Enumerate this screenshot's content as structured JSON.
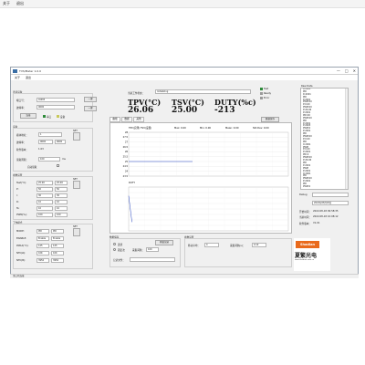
{
  "menubar": {
    "items": [
      "关于",
      "退出"
    ]
  },
  "window": {
    "title": "TVS/Meter 1.0.0",
    "min": "—",
    "max": "□",
    "close": "✕"
  },
  "app_menu": {
    "items": [
      "关于",
      "退出"
    ]
  },
  "connection": {
    "group_label": "连接设备",
    "port_label": "端口号：",
    "port_value": "COM3",
    "baud_label": "波特率：",
    "baud_value": "9600",
    "connect_btn": "连接",
    "serial_label": "串口",
    "device_label": "设备"
  },
  "device": {
    "group_label": "设备",
    "addr_label": "模块地址：",
    "addr_value": "1",
    "rate_label": "波特率：",
    "rate_value": "9600",
    "ver_label": "软件版本：",
    "ver_value": "1.03",
    "read_label": "读取周期：",
    "read_value": "100",
    "read_unit": "ms",
    "auto_label": "自动读取",
    "set_btn": "SET"
  },
  "params": {
    "group_label": "参数设置",
    "rows": [
      {
        "label": "Tset(°C):",
        "v1": "25.00",
        "v2": "25.00"
      },
      {
        "label": "P:",
        "v1": "50",
        "v2": "50"
      },
      {
        "label": "I:",
        "v1": "30",
        "v2": "30"
      },
      {
        "label": "D:",
        "v1": "10",
        "v2": "10"
      },
      {
        "label": "Ts:",
        "v1": "10",
        "v2": "10"
      },
      {
        "label": "PWM(%):",
        "v1": "100",
        "v2": "100"
      }
    ],
    "set_btn": "SET"
  },
  "mode": {
    "group_label": "工作模式",
    "rows": [
      {
        "label": "MODE:",
        "value": "PID"
      },
      {
        "label": "ENABLE:",
        "value": "Enable"
      },
      {
        "label": "PMAX(°C):",
        "value": "125"
      },
      {
        "label": "NTC(Ω):",
        "value": "10K"
      },
      {
        "label": "NTC(B):",
        "value": "3950"
      }
    ],
    "set_btn": "SET"
  },
  "top_buttons": {
    "btn1": "一键",
    "btn2": "一键"
  },
  "work_state": {
    "label": "当前工作状态：",
    "value": "Initializing"
  },
  "readouts": {
    "tpv_label": "TPV(°C)",
    "tpv_value": "26.06",
    "tsv_label": "TSV(°C)",
    "tsv_value": "25.00",
    "duty_label": "DUTY(%c)",
    "duty_value": "-213"
  },
  "status_legend": {
    "items": [
      "Test",
      "Ready",
      "Error"
    ],
    "colors": [
      "#2e8b3a",
      "#9a9a9a",
      "#9a9a9a"
    ]
  },
  "tabs": [
    "曲线",
    "数据",
    "其他"
  ],
  "save_btn": "数据保存",
  "chart_header": {
    "title": "TPV(实测) TSV(设置)",
    "max": "Max: 0.00",
    "min": "Min: 0.00",
    "mean": "Mean: 0.00",
    "std": "Std.Dev: 0.00"
  },
  "chart_data": [
    {
      "type": "line",
      "title": "",
      "ylabel": "",
      "x": [
        0,
        1,
        2,
        3,
        4
      ],
      "series": [
        {
          "name": "",
          "values": [
            25,
            25,
            25,
            25,
            25
          ]
        }
      ],
      "ylim": [
        23.5,
        28
      ],
      "yticks": [
        "28",
        "27.5",
        "27",
        "26.5",
        "26",
        "25.5",
        "25",
        "24.5",
        "24",
        "23.5"
      ],
      "xticks": [
        "0",
        "1",
        "2",
        "3",
        "4",
        "5",
        "6",
        "7",
        "8",
        "9",
        "10"
      ],
      "grid": true
    },
    {
      "type": "line",
      "title": "DUTY",
      "x": [
        0,
        1,
        2,
        3
      ],
      "series": [
        {
          "name": "",
          "values": [
            -20,
            -40,
            -60,
            -80
          ]
        }
      ],
      "ylim": [
        -100,
        0
      ],
      "grid": true
    }
  ],
  "data_save": {
    "group_label": "数据保存",
    "opt1": "连续",
    "opt2": "固定次",
    "interval_label": "采集间隔：",
    "interval_value": "100",
    "record_btn": "开始记录",
    "file_label": "记录文件："
  },
  "param_settings": {
    "group_label": "参数设置",
    "item1_label": "移动平均：",
    "item1_value": "4",
    "item2_label": "采集间隔(s)：",
    "item2_value": "0.10"
  },
  "listbox": {
    "title": "Raw Data",
    "rows": [
      "0:2001",
      "PID",
      "D:2001",
      "PID",
      "P:2001",
      "PWM:00",
      "P:0.00",
      "PWM:00",
      "P:26.06",
      "P:2001",
      "PID:00",
      "PWM:00",
      "PID",
      "P:2001",
      "P:2003",
      "PWM:0",
      "P:2001",
      "PID",
      "PWM:00",
      "P:0.00",
      "PID",
      "0:2001",
      "PWM",
      "P:0.00",
      "P:2001",
      "PID:0",
      "PWM:00",
      "P:26.06",
      "PID",
      "P:2001",
      "PWM",
      "P:2001",
      "0:2001",
      "PID",
      "PWM:00",
      "P:2001",
      "PID",
      "PWM:0"
    ]
  },
  "info": {
    "debug_label": "Debug",
    "datetime_value": "2022年08月18日",
    "open_label": "开始时间：",
    "open_value": "2022-08-18 09:58:35",
    "current_label": "当前时间：",
    "current_value": "2022-08-18 10:08:12",
    "ver_label": "软件版本：",
    "ver_value": "V1.01"
  },
  "logo": {
    "brand": "Shadian",
    "name_cn": "夏繁光电",
    "url": "www.shadian.com.cn"
  },
  "statusbar": {
    "text": "串口已连接"
  }
}
